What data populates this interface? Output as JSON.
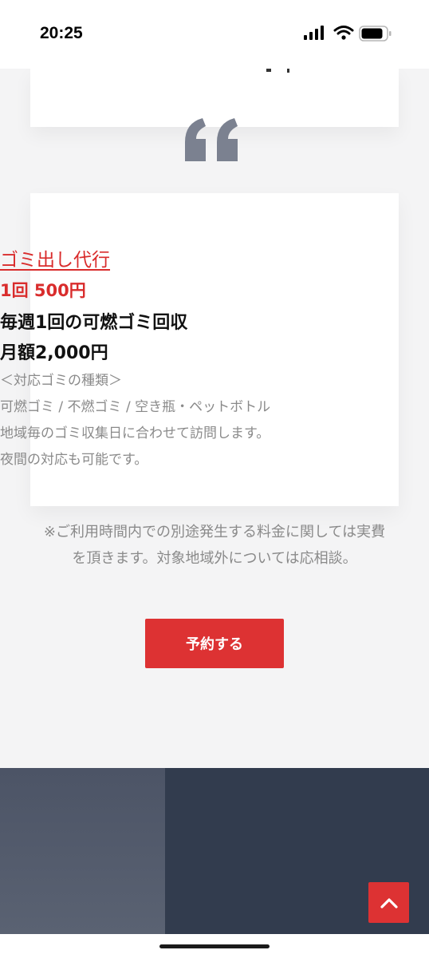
{
  "status_bar": {
    "time": "20:25",
    "icons": [
      "cellular-signal-icon",
      "wifi-icon",
      "battery-icon"
    ]
  },
  "service": {
    "title": "ゴミ出し代行",
    "price_per": "1回 500円",
    "weekly": "毎週1回の可燃ゴミ回収",
    "monthly": "月額2,000円",
    "types_heading": "＜対応ゴミの種類＞",
    "types_list": "可燃ゴミ / 不燃ゴミ / 空き瓶・ペットボトル",
    "visit_note": "地域毎のゴミ収集日に合わせて訪問します。",
    "night_note": "夜間の対応も可能です。"
  },
  "fee_note": {
    "line1": "※ご利用時間内での別途発生する料金に関しては実費",
    "line2": "を頂きます。対象地域外については応相談。"
  },
  "reserve_button": {
    "label": "予約する"
  },
  "testimonial": {
    "icon": "quote-icon"
  },
  "scroll_top": {
    "icon": "chevron-up-icon"
  },
  "colors": {
    "accent": "#dd3233",
    "accent_text": "#d92c2c",
    "page_bg": "#f4f4f5",
    "dark_section": "#323c4e",
    "muted_text": "#8a8a8a"
  }
}
